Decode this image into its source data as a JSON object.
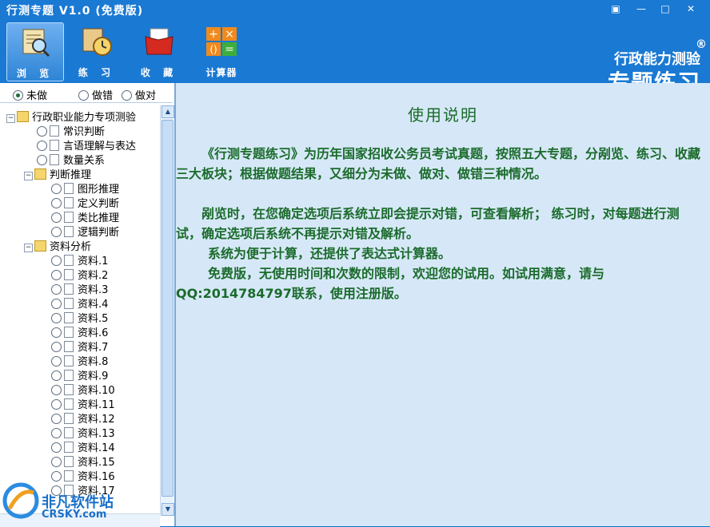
{
  "window": {
    "title": "行测专题 V1.0 (免费版)",
    "controls": [
      "▣",
      "—",
      "□",
      "✕"
    ]
  },
  "toolbar": {
    "items": [
      {
        "label": "浏 览",
        "icon": "browse-icon"
      },
      {
        "label": "练 习",
        "icon": "practice-icon"
      },
      {
        "label": "收 藏",
        "icon": "favorites-icon"
      },
      {
        "label": "计算器",
        "icon": "calculator-icon"
      }
    ],
    "brand_line1": "行政能力测验",
    "brand_line2": "专题练习",
    "reg_mark": "®"
  },
  "filter": {
    "options": [
      "未做",
      "做错",
      "做对"
    ],
    "selected": "未做"
  },
  "tree": {
    "root": "行政职业能力专项测验",
    "items": [
      {
        "label": "常识判断",
        "level": 1
      },
      {
        "label": "言语理解与表达",
        "level": 1
      },
      {
        "label": "数量关系",
        "level": 1
      },
      {
        "label": "判断推理",
        "level": 0,
        "folder": true
      },
      {
        "label": "图形推理",
        "level": 2
      },
      {
        "label": "定义判断",
        "level": 2
      },
      {
        "label": "类比推理",
        "level": 2
      },
      {
        "label": "逻辑判断",
        "level": 2
      },
      {
        "label": "资料分析",
        "level": 0,
        "folder": true
      },
      {
        "label": "资料.1",
        "level": 2
      },
      {
        "label": "资料.2",
        "level": 2
      },
      {
        "label": "资料.3",
        "level": 2
      },
      {
        "label": "资料.4",
        "level": 2
      },
      {
        "label": "资料.5",
        "level": 2
      },
      {
        "label": "资料.6",
        "level": 2
      },
      {
        "label": "资料.7",
        "level": 2
      },
      {
        "label": "资料.8",
        "level": 2
      },
      {
        "label": "资料.9",
        "level": 2
      },
      {
        "label": "资料.10",
        "level": 2
      },
      {
        "label": "资料.11",
        "level": 2
      },
      {
        "label": "资料.12",
        "level": 2
      },
      {
        "label": "资料.13",
        "level": 2
      },
      {
        "label": "资料.14",
        "level": 2
      },
      {
        "label": "资料.15",
        "level": 2
      },
      {
        "label": "资料.16",
        "level": 2
      },
      {
        "label": "资料.17",
        "level": 2
      }
    ]
  },
  "main": {
    "heading": "使用说明",
    "paragraphs": [
      "《行测专题练习》为历年国家招收公务员考试真题，按照五大专题，分剐览、练习、收藏三大板块；根据做题结果，又细分为未做、做对、做错三种情况。",
      "剐览时，在您确定选项后系统立即会提示对错，可查看解析； 练习时，对每题进行测试，确定选项后系统不再提示对错及解析。",
      "系统为便于计算，还提供了表达式计算器。",
      "免费版，无使用时间和次数的限制，欢迎您的试用。如试用满意，请与QQ:2014784797联系，使用注册版。"
    ]
  },
  "watermark": {
    "line1": "非凡软件站",
    "line2": "CRSKY.com"
  }
}
